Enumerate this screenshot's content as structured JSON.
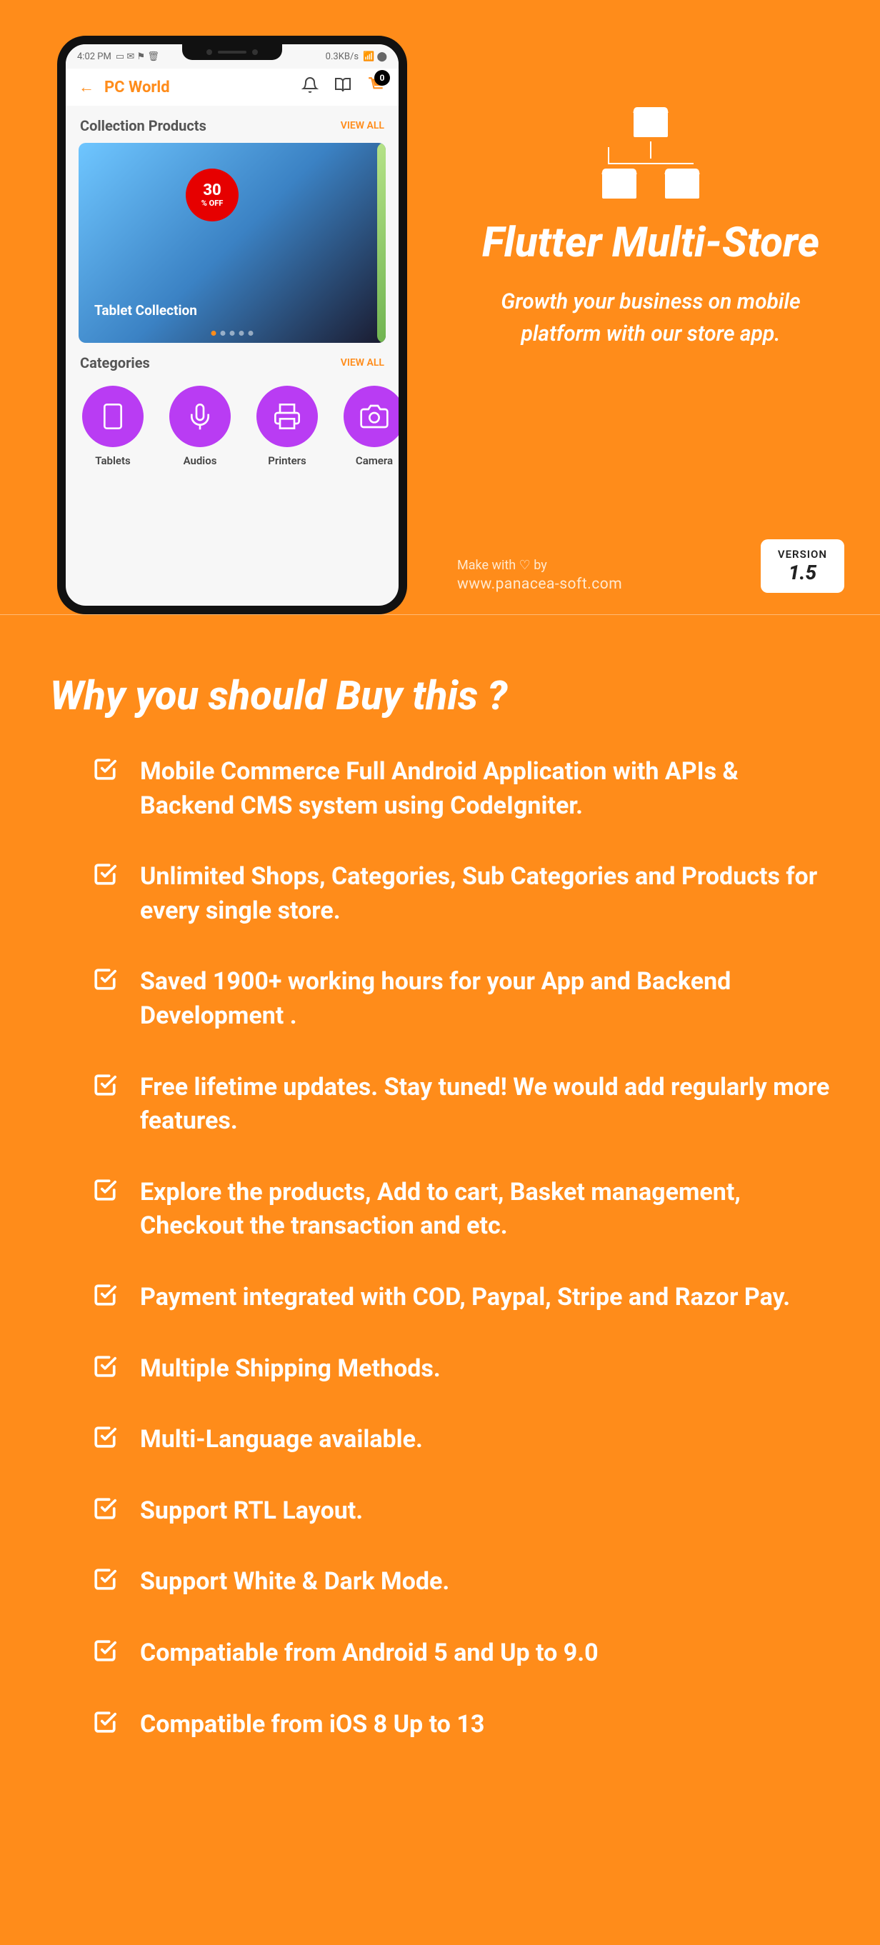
{
  "phone": {
    "status_left_time": "4:02 PM",
    "status_right_net": "0.3KB/s",
    "appbar_title": "PC World",
    "cart_badge": "0",
    "section1_title": "Collection Products",
    "view_all": "VIEW ALL",
    "offer_num": "30",
    "offer_off": "% OFF",
    "banner_label": "Tablet Collection",
    "section2_title": "Categories",
    "categories": [
      {
        "label": "Tablets"
      },
      {
        "label": "Audios"
      },
      {
        "label": "Printers"
      },
      {
        "label": "Camera"
      }
    ]
  },
  "hero": {
    "title": "Flutter Multi-Store",
    "subtitle": "Growth your business on mobile platform with our store app.",
    "made_prefix": "Make with",
    "made_suffix": "by",
    "url": "www.panacea-soft.com",
    "version_label": "VERSION",
    "version_num": "1.5"
  },
  "features_heading": "Why you should Buy this ?",
  "features": [
    "Mobile Commerce Full Android Application with APIs & Backend CMS system using CodeIgniter.",
    "Unlimited Shops, Categories, Sub Categories and Products for every single store.",
    "Saved 1900+ working hours for your App and Backend Development .",
    "Free lifetime updates. Stay tuned! We would add regularly more features.",
    "Explore the products, Add to cart, Basket management, Checkout the transaction and etc.",
    "Payment integrated with COD, Paypal, Stripe and Razor Pay.",
    "Multiple Shipping Methods.",
    "Multi-Language available.",
    "Support RTL Layout.",
    "Support White & Dark Mode.",
    "Compatiable from Android 5 and Up to 9.0",
    "Compatible from iOS 8 Up to 13"
  ]
}
